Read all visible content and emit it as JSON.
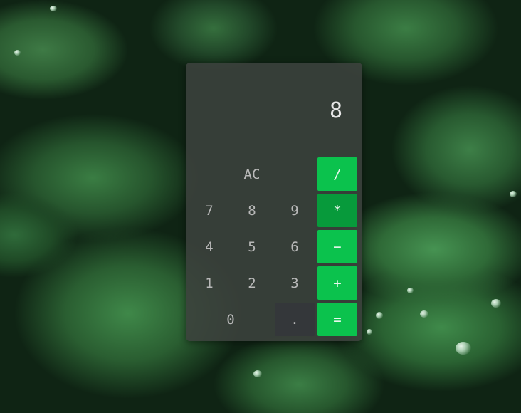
{
  "calculator": {
    "display": "8",
    "keys": {
      "clear": "AC",
      "divide": "/",
      "multiply": "*",
      "subtract": "−",
      "add": "+",
      "equals": "=",
      "seven": "7",
      "eight": "8",
      "nine": "9",
      "four": "4",
      "five": "5",
      "six": "6",
      "one": "1",
      "two": "2",
      "three": "3",
      "zero": "0",
      "decimal": "."
    },
    "active_operator": "multiply",
    "colors": {
      "operator": "#0bc24d",
      "operator_active": "#079a3b",
      "panel": "#3c423e",
      "decimal_key": "#34373a"
    }
  }
}
